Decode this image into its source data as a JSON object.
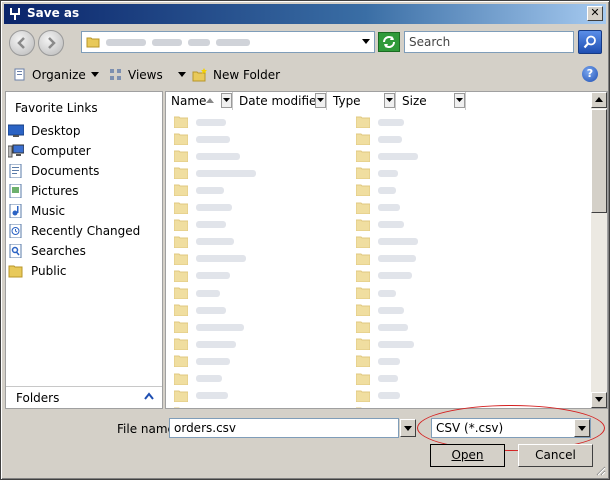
{
  "window": {
    "title": "Save as",
    "close_label": "✕"
  },
  "search": {
    "placeholder": "Search"
  },
  "toolbar": {
    "organize_label": "Organize",
    "views_label": "Views",
    "new_folder_label": "New Folder",
    "help_label": "?"
  },
  "sidebar": {
    "title": "Favorite Links",
    "items": [
      {
        "label": "Desktop",
        "icon": "desktop-icon"
      },
      {
        "label": "Computer",
        "icon": "computer-icon"
      },
      {
        "label": "Documents",
        "icon": "documents-icon"
      },
      {
        "label": "Pictures",
        "icon": "pictures-icon"
      },
      {
        "label": "Music",
        "icon": "music-icon"
      },
      {
        "label": "Recently Changed",
        "icon": "recent-icon"
      },
      {
        "label": "Searches",
        "icon": "searches-icon"
      },
      {
        "label": "Public",
        "icon": "folder-icon"
      }
    ],
    "folders_label": "Folders"
  },
  "file_list": {
    "columns": [
      {
        "label": "Name"
      },
      {
        "label": "Date modified"
      },
      {
        "label": "Type"
      },
      {
        "label": "Size"
      }
    ]
  },
  "bottom": {
    "file_name_label": "File name:",
    "file_name_value": "orders.csv",
    "save_type_value": "CSV (*.csv)",
    "open_label": "Open",
    "cancel_label": "Cancel"
  },
  "colors": {
    "accent": "#0a246a",
    "highlight_ellipse": "#d42020"
  }
}
